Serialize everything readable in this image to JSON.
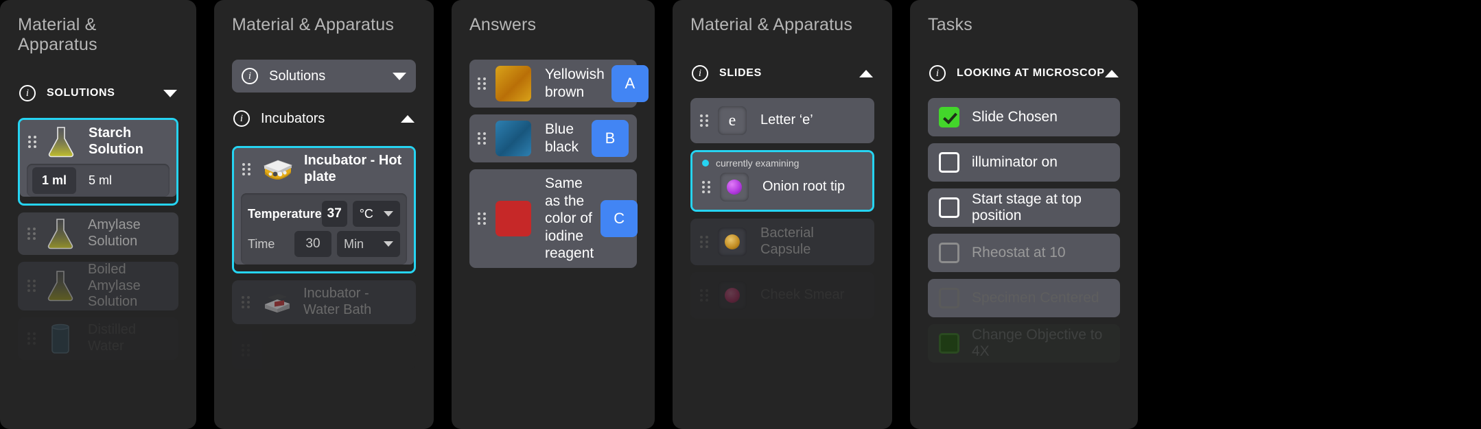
{
  "panels": [
    {
      "title": "Material & Apparatus",
      "section": {
        "label": "SOLUTIONS",
        "caret": "down",
        "icon": "info-icon"
      },
      "items": [
        {
          "label": "Starch Solution",
          "selected": true,
          "amounts": [
            "1 ml",
            "5 ml"
          ],
          "active_amount": "1 ml",
          "icon": "flask-icon"
        },
        {
          "label": "Amylase Solution",
          "selected": false,
          "icon": "flask-icon"
        },
        {
          "label": "Boiled Amylase Solution",
          "selected": false,
          "icon": "flask-icon"
        },
        {
          "label": "Distilled Water",
          "selected": false,
          "icon": "beaker-icon"
        }
      ]
    },
    {
      "title": "Material & Apparatus",
      "sections": [
        {
          "label": "Solutions",
          "caret": "down",
          "icon": "info-icon",
          "boxed": true
        },
        {
          "label": "Incubators",
          "caret": "up",
          "icon": "info-icon",
          "boxed": false
        }
      ],
      "items": [
        {
          "label": "Incubator - Hot plate",
          "selected": true,
          "icon": "hotplate-icon",
          "settings": [
            {
              "name": "Temperature",
              "value": "37",
              "unit": "°C"
            },
            {
              "name": "Time",
              "value": "30",
              "unit": "Min"
            }
          ]
        },
        {
          "label": "Incubator - Water Bath",
          "selected": false,
          "icon": "waterbath-icon"
        }
      ]
    },
    {
      "title": "Answers",
      "answers": [
        {
          "text": "Yellowish brown",
          "key": "A",
          "color": "#c8860d"
        },
        {
          "text": "Blue black",
          "key": "B",
          "color": "#1d6ea0"
        },
        {
          "text": "Same as the color of iodine reagent",
          "key": "C",
          "color": "#c62828"
        }
      ]
    },
    {
      "title": "Material & Apparatus",
      "section": {
        "label": "SLIDES",
        "caret": "up",
        "icon": "info-icon"
      },
      "items": [
        {
          "label": "Letter ‘e’",
          "selected": false,
          "thumb": "letter-e-thumb"
        },
        {
          "label": "Onion root tip",
          "selected": true,
          "tag": "currently examining",
          "thumb": "onion-root-tip-thumb",
          "thumb_color": "#b43ce0"
        },
        {
          "label": "Bacterial Capsule",
          "selected": false,
          "thumb": "bacterial-capsule-thumb",
          "thumb_color": "#c08a20"
        },
        {
          "label": "Cheek Smear",
          "selected": false,
          "thumb": "cheek-smear-thumb",
          "thumb_color": "#c02060"
        }
      ]
    },
    {
      "title": "Tasks",
      "section": {
        "label": "LOOKING AT MICROSCOPE",
        "caret": "up",
        "icon": "info-icon"
      },
      "tasks": [
        {
          "label": "Slide Chosen",
          "checked": true
        },
        {
          "label": "illuminator on",
          "checked": false
        },
        {
          "label": "Start stage at top position",
          "checked": false
        },
        {
          "label": "Rheostat at 10",
          "checked": false
        },
        {
          "label": "Specimen Centered",
          "checked": false
        },
        {
          "label": "Change Objective to 4X",
          "checked": true
        }
      ]
    }
  ],
  "colors": {
    "selection_outline": "#26d4f2",
    "answer_key_badge": "#4285f4",
    "checkbox_checked": "#43d62b",
    "panel_background": "#252525",
    "row_background": "#55565e"
  }
}
